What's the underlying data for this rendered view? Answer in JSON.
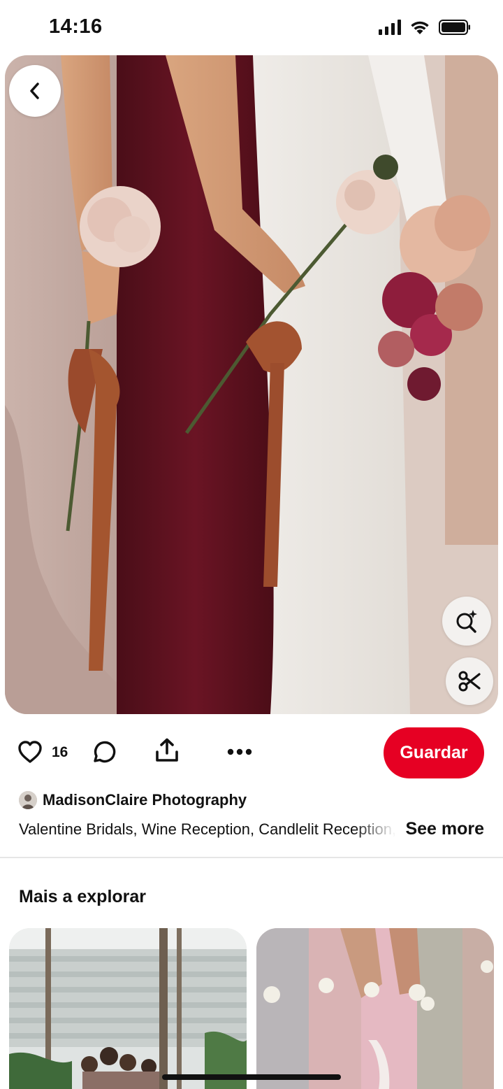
{
  "status_bar": {
    "time": "14:16"
  },
  "pin": {
    "like_count": "16",
    "save_label": "Guardar",
    "creator_name": "MadisonClaire Photography",
    "description": "Valentine Bridals, Wine Reception, Candlelit Reception, Ivory Bridal",
    "see_more_label": "See more"
  },
  "explore": {
    "heading": "Mais a explorar"
  },
  "colors": {
    "accent_red": "#e60023",
    "text": "#111111",
    "divider": "#e6e6e6"
  },
  "icons": {
    "back": "chevron-left-icon",
    "visual_search": "lens-sparkle-icon",
    "cutout": "scissors-icon",
    "like": "heart-icon",
    "comment": "comment-bubble-icon",
    "share": "share-upload-icon",
    "more": "ellipsis-icon"
  }
}
